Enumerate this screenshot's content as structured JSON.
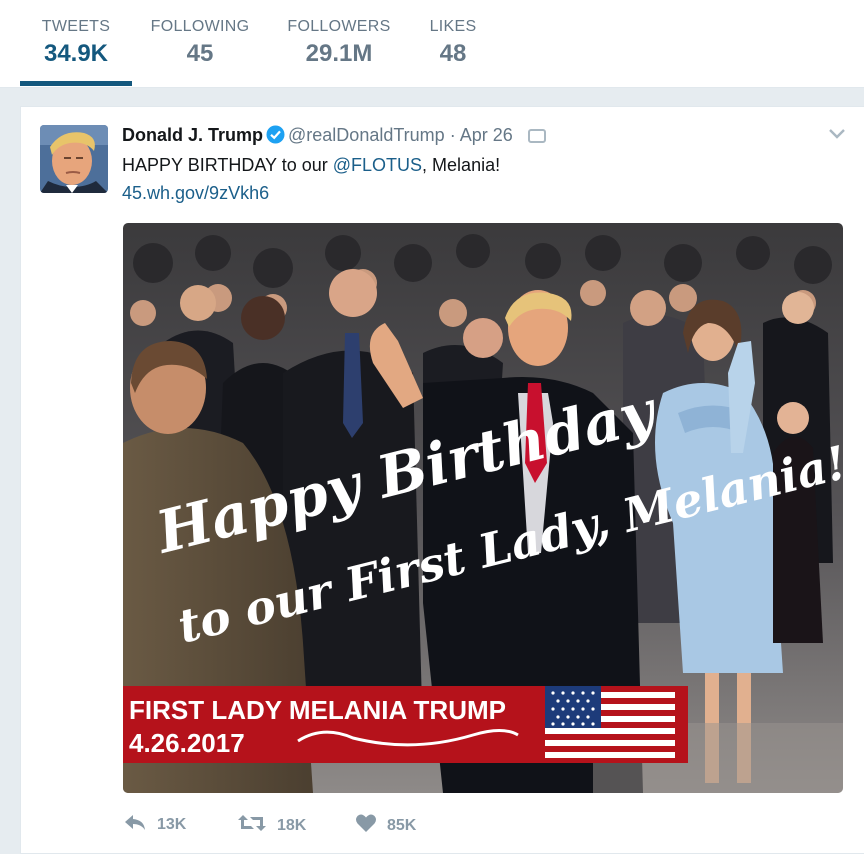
{
  "profile_nav": {
    "stats": [
      {
        "label": "TWEETS",
        "value": "34.9K"
      },
      {
        "label": "FOLLOWING",
        "value": "45"
      },
      {
        "label": "FOLLOWERS",
        "value": "29.1M"
      },
      {
        "label": "LIKES",
        "value": "48"
      }
    ]
  },
  "tweet": {
    "fullname": "Donald J. Trump",
    "handle": "@realDonaldTrump",
    "separator": "·",
    "time": "Apr 26",
    "text_before": "HAPPY BIRTHDAY to our ",
    "mention": "@FLOTUS",
    "text_after": ", Melania!",
    "link": "45.wh.gov/9zVkh6",
    "image": {
      "script_line1": "Happy Birthday",
      "script_line2": "to our First Lady, Melania!",
      "banner_title": "FIRST LADY MELANIA TRUMP",
      "banner_date": "4.26.2017"
    },
    "actions": {
      "reply_count": "13K",
      "retweet_count": "18K",
      "like_count": "85K"
    }
  },
  "colors": {
    "link": "#1b5f8a",
    "active_stat": "#14587e",
    "muted": "#657786",
    "banner_red": "#b5121b",
    "dress_blue": "#a9c8e4"
  }
}
